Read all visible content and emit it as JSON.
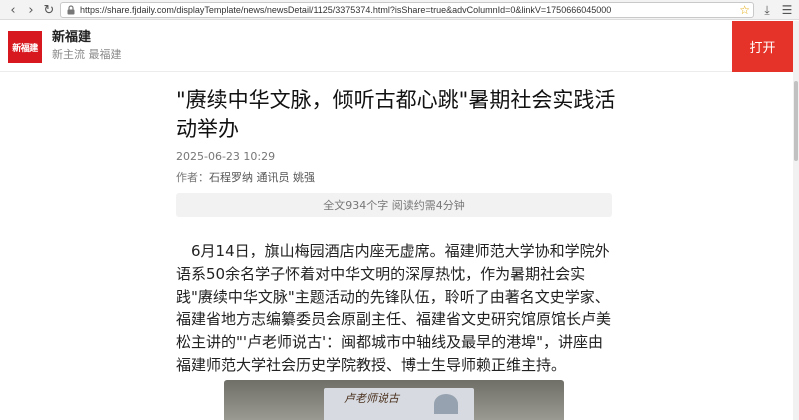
{
  "browser": {
    "url": "https://share.fjdaily.com/displayTemplate/news/newsDetail/1125/3375374.html?isShare=true&advColumnId=0&linkV=1750666045000",
    "icons": {
      "back": "back-arrow-icon",
      "forward": "forward-arrow-icon",
      "reload": "reload-icon",
      "lock": "lock-icon",
      "bookmark": "star-icon",
      "download": "download-icon",
      "menu": "menu-icon"
    }
  },
  "banner": {
    "logo_text": "新福建",
    "app_name": "新福建",
    "slogan": "新主流 最福建",
    "open_label": "打开",
    "brand_color": "#e6332a"
  },
  "article": {
    "title": "\"赓续中华文脉，倾听古都心跳\"暑期社会实践活动举办",
    "date": "2025-06-23 10:29",
    "author_label": "作者：",
    "authors": "石程罗纳 通讯员 姚强",
    "reading_info": "全文934个字 阅读约需4分钟",
    "paragraph": "6月14日，旗山梅园酒店内座无虚席。福建师范大学协和学院外语系50余名学子怀着对中华文明的深厚热忱，作为暑期社会实践\"赓续中华文脉\"主题活动的先锋队伍，聆听了由著名文史学家、福建省地方志编纂委员会原副主任、福建省文史研究馆原馆长卢美松主讲的\"'卢老师说古'：闽都城市中轴线及最早的港埠\"，讲座由福建师范大学社会历史学院教授、博士生导师赖正维主持。",
    "photo_caption_text": "卢老师说古"
  }
}
